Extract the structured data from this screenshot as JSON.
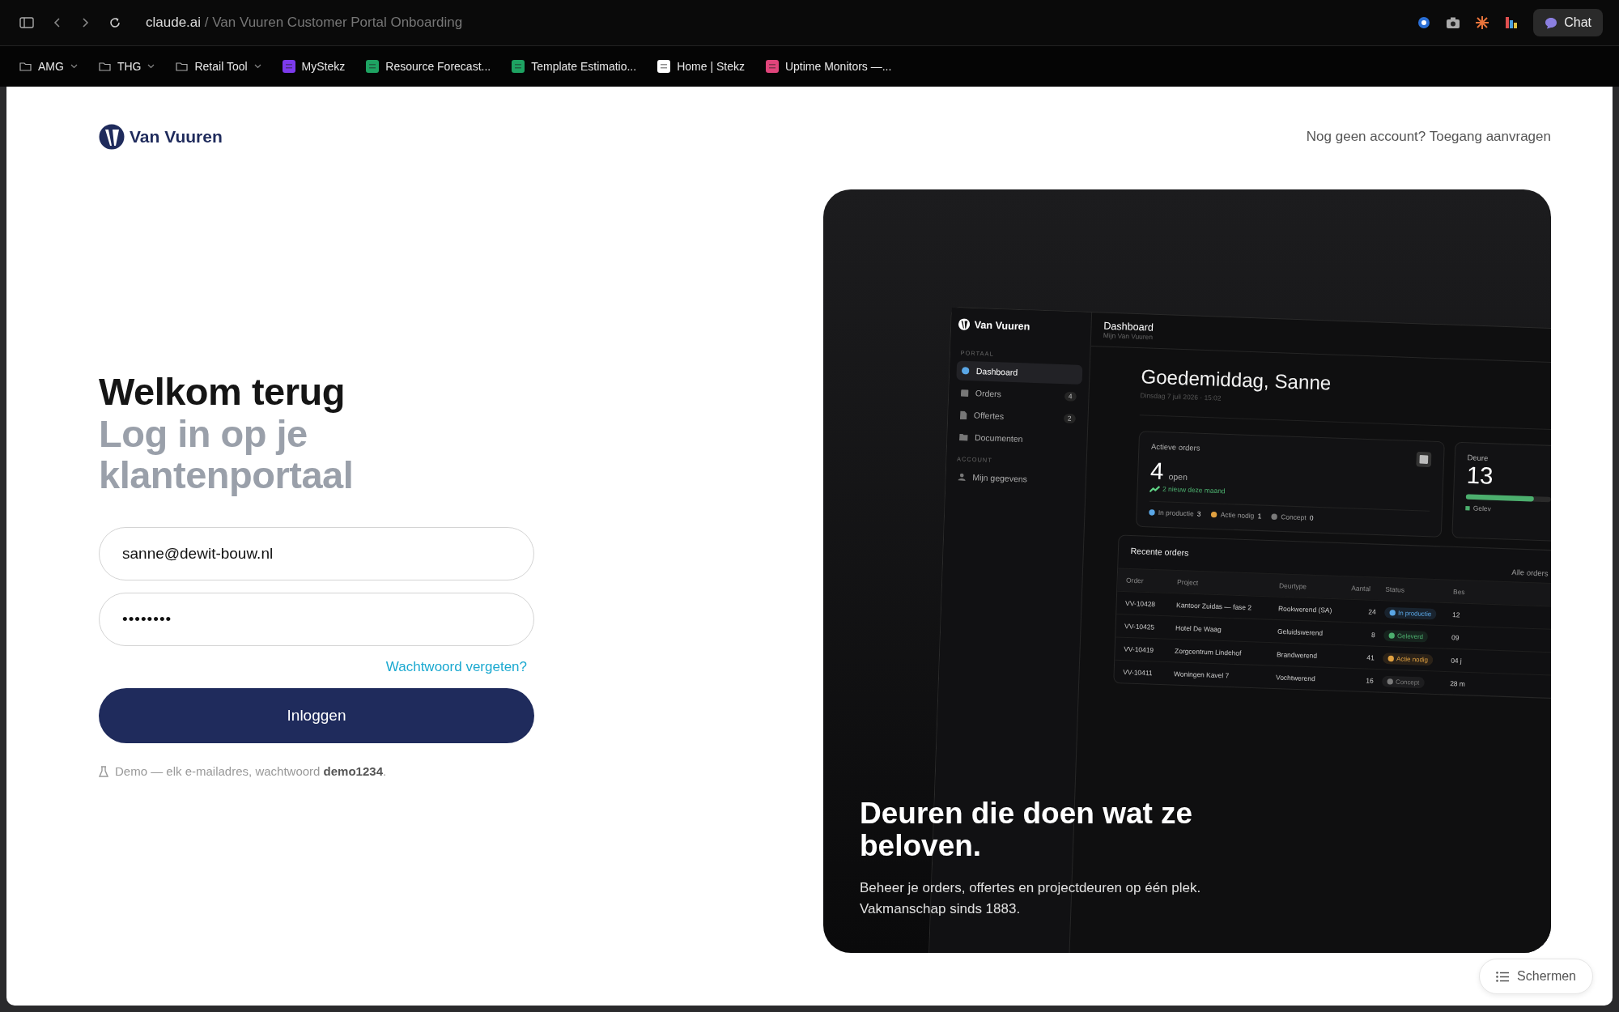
{
  "browser": {
    "url_host": "claude.ai",
    "url_path": "/ Van Vuuren Customer Portal Onboarding",
    "chat_button": "Chat"
  },
  "bookmarks": [
    {
      "label": "AMG",
      "kind": "folder"
    },
    {
      "label": "THG",
      "kind": "folder"
    },
    {
      "label": "Retail Tool",
      "kind": "folder"
    },
    {
      "label": "MyStekz",
      "kind": "site",
      "color": "#7c3aed"
    },
    {
      "label": "Resource Forecast...",
      "kind": "site",
      "color": "#1ea362"
    },
    {
      "label": "Template Estimatio...",
      "kind": "site",
      "color": "#1ea362"
    },
    {
      "label": "Home | Stekz",
      "kind": "site",
      "color": "#ffffff"
    },
    {
      "label": "Uptime Monitors —...",
      "kind": "site",
      "color": "#e0457b"
    }
  ],
  "header": {
    "brand": "Van Vuuren",
    "signup_link": "Nog geen account? Toegang aanvragen"
  },
  "login": {
    "title": "Welkom terug",
    "subtitle": "Log in op je klantenportaal",
    "email": {
      "value": "sanne@dewit-bouw.nl"
    },
    "password": {
      "value": "••••••••"
    },
    "forgot_link": "Wachtwoord vergeten?",
    "submit": "Inloggen",
    "demo_note": "Demo — elk e-mailadres, wachtwoord **demo1234**."
  },
  "hero": {
    "title": "Deuren die doen wat ze beloven.",
    "body": "Beheer je orders, offertes en projectdeuren op één plek. Vakmanschap sinds 1883."
  },
  "dashboard": {
    "brand": "Van Vuuren",
    "sections": [
      {
        "label": "PORTAAL",
        "items": [
          {
            "label": "Dashboard",
            "selected": true
          },
          {
            "label": "Orders",
            "badge": "4",
            "selected": false
          },
          {
            "label": "Offertes",
            "badge": "2",
            "selected": false
          },
          {
            "label": "Documenten",
            "selected": false
          }
        ]
      },
      {
        "label": "ACCOUNT",
        "items": [
          {
            "label": "Mijn gegevens",
            "selected": false
          }
        ]
      }
    ],
    "header": {
      "title": "Dashboard",
      "subtitle": "Mijn Van Vuuren"
    },
    "greeting": "Goedemiddag, Sanne",
    "date": "Dinsdag 7 juli 2026 · 15:02",
    "card": {
      "title": "Actieve orders",
      "value": "4",
      "unit": "open",
      "trend": "2 nieuw deze maand",
      "legend": [
        {
          "label": "In productie",
          "count": "3",
          "color": "#5aa7e6"
        },
        {
          "label": "Actie nodig",
          "count": "1",
          "color": "#e0a040"
        },
        {
          "label": "Concept",
          "count": "0",
          "color": "#7a7a7a"
        }
      ]
    },
    "card2": {
      "title": "Deure",
      "value": "13",
      "level": 0.8,
      "legend": "Gelev"
    },
    "recent": {
      "title": "Recente orders",
      "link": "Alle orders",
      "columns": [
        "Order",
        "Project",
        "Deurtype",
        "Aantal",
        "Status",
        "Bes"
      ],
      "rows": [
        {
          "order": "VV-10428",
          "project": "Kantoor Zuidas — fase 2",
          "type": "Rookwerend (SA)",
          "count": "24",
          "status": "In productie",
          "color": "#5aa7e6",
          "column_6": "12"
        },
        {
          "order": "VV-10425",
          "project": "Hotel De Waag",
          "type": "Geluidswerend",
          "count": "8",
          "status": "Geleverd",
          "color": "#4caf6e",
          "column_6": "09"
        },
        {
          "order": "VV-10419",
          "project": "Zorgcentrum Lindehof",
          "type": "Brandwerend",
          "count": "41",
          "status": "Actie nodig",
          "color": "#e0a040",
          "column_6": "04 j"
        },
        {
          "order": "VV-10411",
          "project": "Woningen Kavel 7",
          "type": "Vochtwerend",
          "count": "16",
          "status": "Concept",
          "color": "#7a7a7a",
          "column_6": "28 m"
        }
      ]
    }
  },
  "screens_button": "Schermen"
}
